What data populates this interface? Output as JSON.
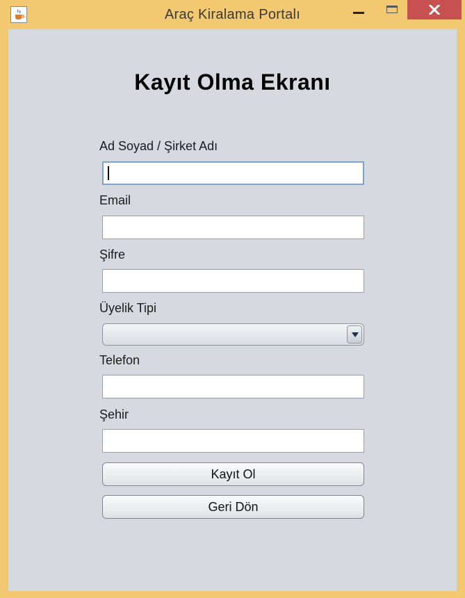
{
  "window": {
    "title": "Araç Kiralama Portalı",
    "icon": "java-cup-icon",
    "controls": [
      "minimize-icon",
      "maximize-icon",
      "close-icon"
    ]
  },
  "form": {
    "heading": "Kayıt Olma Ekranı",
    "fields": [
      {
        "label": "Ad Soyad / Şirket Adı",
        "value": "",
        "focused": true
      },
      {
        "label": "Email",
        "value": ""
      },
      {
        "label": "Şifre",
        "value": ""
      },
      {
        "label": "Üyelik Tipi",
        "value": "",
        "type": "select"
      },
      {
        "label": "Telefon",
        "value": ""
      },
      {
        "label": "Şehir",
        "value": ""
      }
    ],
    "register_button": "Kayıt Ol",
    "back_button": "Geri Dön"
  },
  "colors": {
    "frame": "#f2c870",
    "content_bg": "#d6d9e0",
    "close_button": "#c75050",
    "focus_border": "#7da2ce"
  }
}
